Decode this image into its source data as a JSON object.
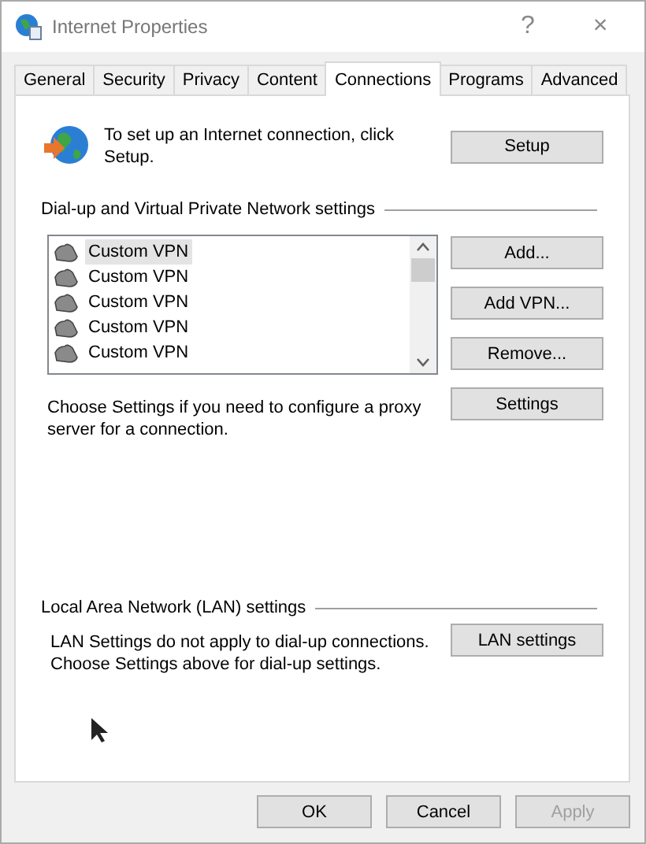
{
  "window": {
    "title": "Internet Properties",
    "help": "?",
    "close": "×"
  },
  "tabs": [
    {
      "label": "General",
      "selected": false
    },
    {
      "label": "Security",
      "selected": false
    },
    {
      "label": "Privacy",
      "selected": false
    },
    {
      "label": "Content",
      "selected": false
    },
    {
      "label": "Connections",
      "selected": true
    },
    {
      "label": "Programs",
      "selected": false
    },
    {
      "label": "Advanced",
      "selected": false
    }
  ],
  "setup": {
    "text": "To set up an Internet connection, click Setup.",
    "button": "Setup"
  },
  "dialup": {
    "heading": "Dial-up and Virtual Private Network settings",
    "connections": [
      {
        "name": "Custom VPN",
        "selected": true
      },
      {
        "name": "Custom VPN",
        "selected": false
      },
      {
        "name": "Custom VPN",
        "selected": false
      },
      {
        "name": "Custom VPN",
        "selected": false
      },
      {
        "name": "Custom VPN",
        "selected": false
      }
    ],
    "buttons": [
      "Add...",
      "Add VPN...",
      "Remove..."
    ],
    "proxy_text": "Choose Settings if you need to configure a proxy server for a connection.",
    "settings_button": "Settings"
  },
  "lan": {
    "heading": "Local Area Network (LAN) settings",
    "text": "LAN Settings do not apply to dial-up connections. Choose Settings above for dial-up settings.",
    "button": "LAN settings"
  },
  "footer": [
    {
      "label": "OK",
      "disabled": false
    },
    {
      "label": "Cancel",
      "disabled": false
    },
    {
      "label": "Apply",
      "disabled": true
    }
  ]
}
